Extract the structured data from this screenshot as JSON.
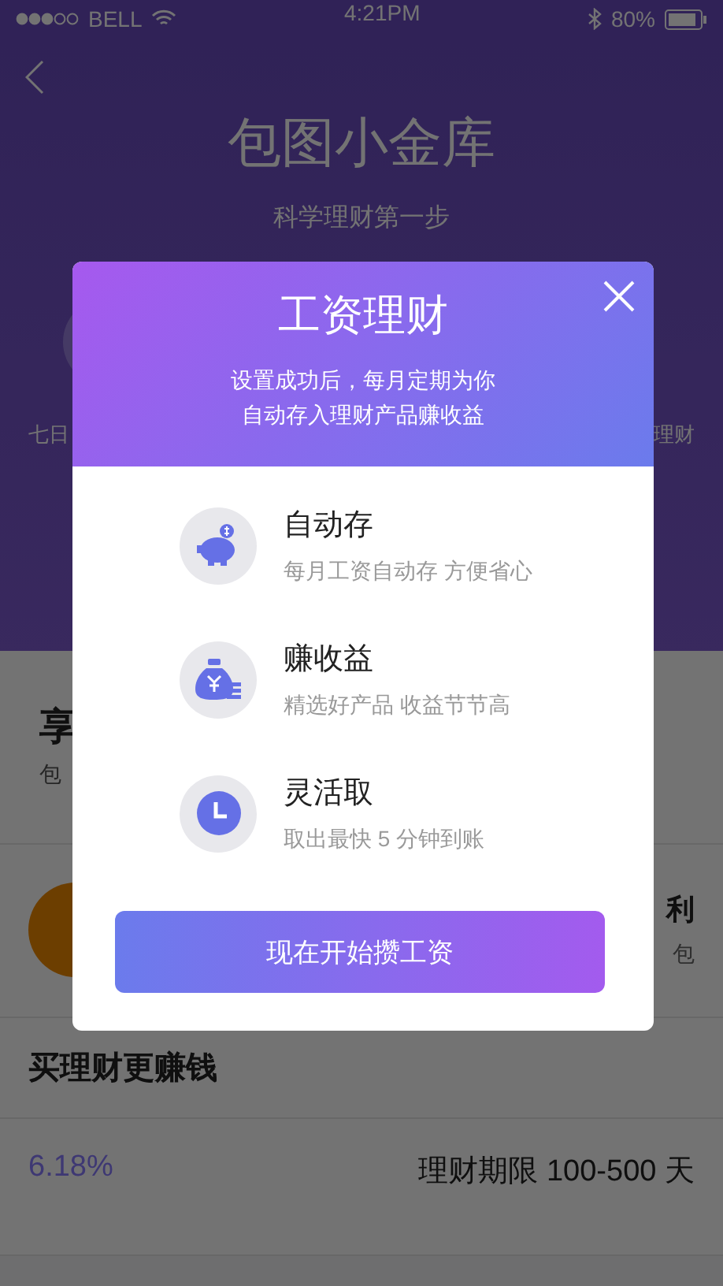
{
  "status_bar": {
    "carrier": "BELL",
    "time": "4:21PM",
    "battery": "80%"
  },
  "header": {
    "title": "包图小金库",
    "subtitle": "科学理财第一步",
    "left_caption": "七日",
    "right_caption": "理财"
  },
  "promo": {
    "title": "享",
    "text": "包"
  },
  "welfare": {
    "title": "利",
    "text": "包"
  },
  "section": {
    "title": "买理财更赚钱",
    "rate": "6.18%",
    "term": "理财期限 100-500 天"
  },
  "dialog": {
    "title": "工资理财",
    "subtitle_lines": [
      "设置成功后，每月定期为你",
      "自动存入理财产品赚收益"
    ],
    "features": [
      {
        "kind": "piggy",
        "title": "自动存",
        "desc": "每月工资自动存 方便省心"
      },
      {
        "kind": "moneybag",
        "title": "赚收益",
        "desc": "精选好产品 收益节节高"
      },
      {
        "kind": "clock",
        "title": "灵活取",
        "desc": "取出最快 5 分钟到账"
      }
    ],
    "button": "现在开始攒工资"
  }
}
